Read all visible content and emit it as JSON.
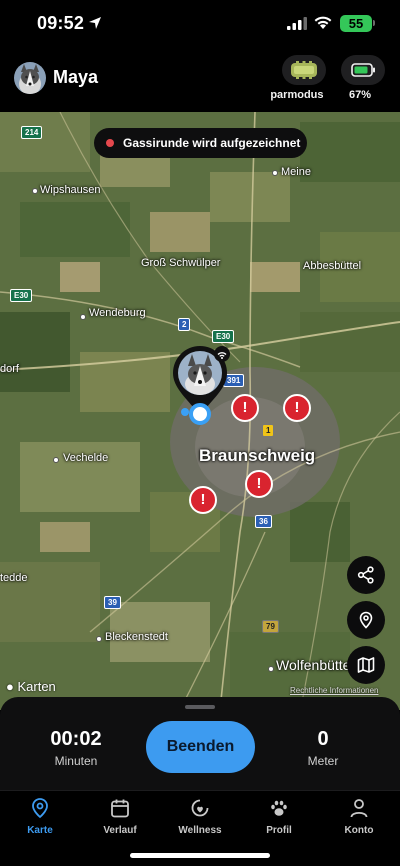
{
  "status_bar": {
    "time": "09:52",
    "battery": "55"
  },
  "header": {
    "dog_name": "Maya",
    "tracker_mode_label": "Sparmodus",
    "tracker_battery": "67%"
  },
  "map": {
    "recording_banner": "Gassirunde wird aufgezeichnet",
    "places": {
      "wipshausen": "Wipshausen",
      "meine": "Meine",
      "gross_schwuelper": "Groß Schwülper",
      "abbesbuettel": "Abbesbüttel",
      "wendeburg": "Wendeburg",
      "vechelde": "Vechelde",
      "braunschweig": "Braunschweig",
      "bleckenstedt": "Bleckenstedt",
      "wolfenbuettel": "Wolfenbütte",
      "edge_left_top": "dorf",
      "edge_left_mid": "tedde",
      "edge_left_bottom": "tte"
    },
    "road_shields": {
      "r214": "214",
      "e30_left": "E30",
      "r2": "2",
      "e30_mid": "E30",
      "r391": "391",
      "r1": "1",
      "r36": "36",
      "r39": "39",
      "r79": "79"
    },
    "warning_symbol": "!",
    "credit": " Karten",
    "legal": "Rechtliche Informationen",
    "colors": {
      "warning": "#d9242f",
      "position": "#3aa0f5"
    }
  },
  "tracking": {
    "duration_value": "00:02",
    "duration_label": "Minuten",
    "end_button": "Beenden",
    "distance_value": "0",
    "distance_label": "Meter"
  },
  "tabs": [
    {
      "label": "Karte",
      "icon": "map-pin-icon",
      "active": true
    },
    {
      "label": "Verlauf",
      "icon": "calendar-icon",
      "active": false
    },
    {
      "label": "Wellness",
      "icon": "wellness-icon",
      "active": false
    },
    {
      "label": "Profil",
      "icon": "paw-icon",
      "active": false
    },
    {
      "label": "Konto",
      "icon": "person-icon",
      "active": false
    }
  ],
  "accent_color": "#3d9bf0"
}
